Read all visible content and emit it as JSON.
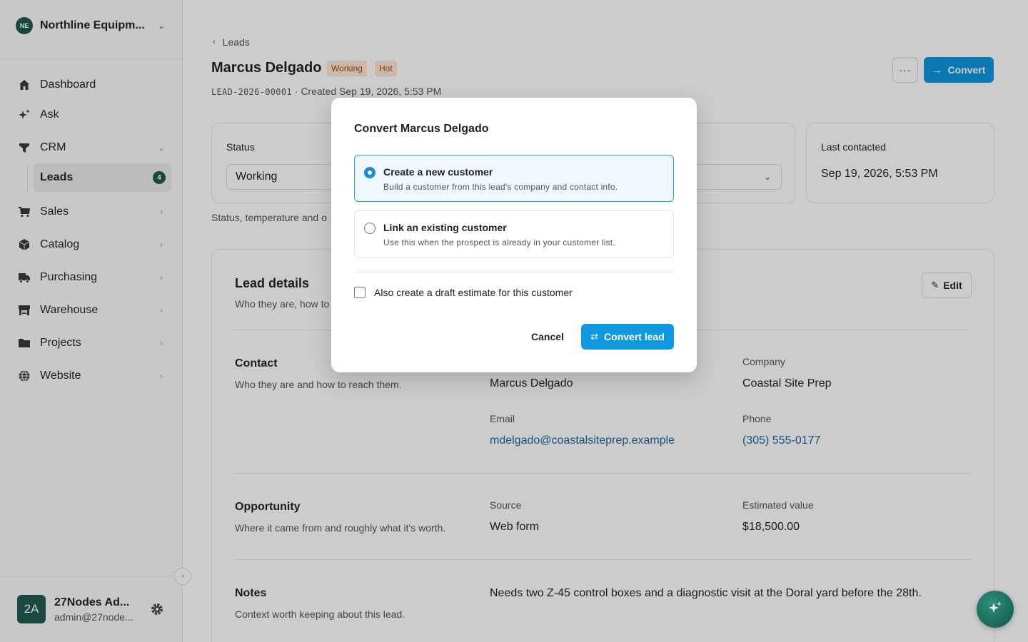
{
  "sidebar": {
    "org_initials": "NE",
    "org_name": "Northline Equipm...",
    "nav": [
      {
        "label": "Dashboard",
        "icon": "home-icon"
      },
      {
        "label": "Ask",
        "icon": "sparkles-icon"
      },
      {
        "label": "CRM",
        "icon": "funnel-icon"
      },
      {
        "label": "Sales",
        "icon": "cart-icon"
      },
      {
        "label": "Catalog",
        "icon": "box-icon"
      },
      {
        "label": "Purchasing",
        "icon": "truck-icon"
      },
      {
        "label": "Warehouse",
        "icon": "warehouse-icon"
      },
      {
        "label": "Projects",
        "icon": "folder-icon"
      },
      {
        "label": "Website",
        "icon": "globe-icon"
      }
    ],
    "crm_sub": {
      "label": "Leads",
      "count": "4"
    },
    "user": {
      "initials": "2A",
      "name": "27Nodes Ad...",
      "email": "admin@27node..."
    }
  },
  "header": {
    "breadcrumb": "Leads",
    "title": "Marcus Delgado",
    "badges": [
      "Working",
      "Hot"
    ],
    "lead_id": "LEAD-2026-00001",
    "created": " · Created Sep 19, 2026, 5:53 PM",
    "convert_label": "Convert",
    "more_label": "···"
  },
  "status_card": {
    "status_label": "Status",
    "status_value": "Working",
    "last_contacted_label": "Last contacted",
    "last_contacted_value": "Sep 19, 2026, 5:53 PM",
    "caption": "Status, temperature and o"
  },
  "details": {
    "title": "Lead details",
    "subtitle": "Who they are, how to",
    "edit_label": "Edit",
    "contact": {
      "title": "Contact",
      "subtitle": "Who they are and how to reach them.",
      "name_value": "Marcus Delgado",
      "company_label": "Company",
      "company_value": "Coastal Site Prep",
      "email_label": "Email",
      "email_value": "mdelgado@coastalsiteprep.example",
      "phone_label": "Phone",
      "phone_value": "(305) 555-0177"
    },
    "opportunity": {
      "title": "Opportunity",
      "subtitle": "Where it came from and roughly what it's worth.",
      "source_label": "Source",
      "source_value": "Web form",
      "value_label": "Estimated value",
      "value_value": "$18,500.00"
    },
    "notes": {
      "title": "Notes",
      "subtitle": "Context worth keeping about this lead.",
      "text": "Needs two Z-45 control boxes and a diagnostic visit at the Doral yard before the 28th."
    }
  },
  "modal": {
    "title": "Convert Marcus Delgado",
    "options": [
      {
        "title": "Create a new customer",
        "desc": "Build a customer from this lead's company and contact info.",
        "selected": true
      },
      {
        "title": "Link an existing customer",
        "desc": "Use this when the prospect is already in your customer list.",
        "selected": false
      }
    ],
    "checkbox_label": "Also create a draft estimate for this customer",
    "cancel_label": "Cancel",
    "convert_label": "Convert lead"
  },
  "colors": {
    "accent": "#1098e0",
    "brand": "#1e5a4f",
    "badge_bg": "#fde8d4",
    "badge_text": "#9a4d14"
  }
}
